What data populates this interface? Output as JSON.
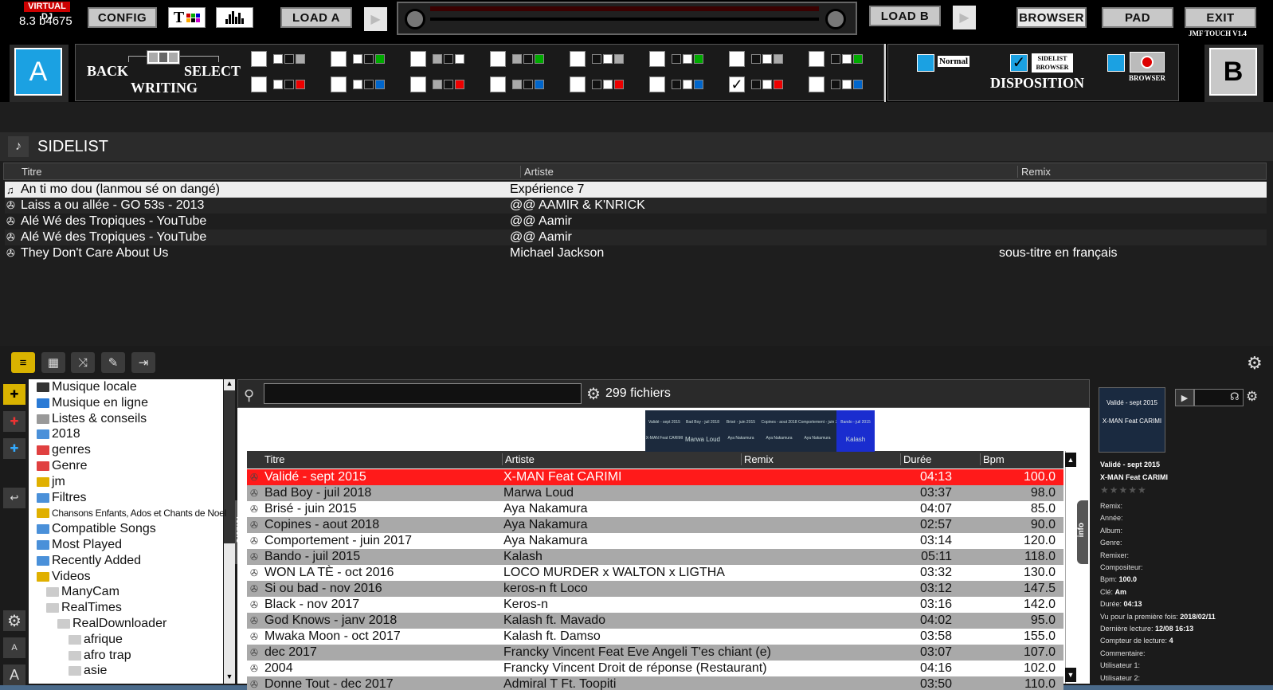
{
  "app": {
    "logo": "VIRTUAL DJ",
    "version": "8.3 b4675",
    "skin_tag": "JMF TOUCH  V1.4"
  },
  "topbar": {
    "config": "CONFIG",
    "load_a": "LOAD A",
    "load_b": "LOAD B",
    "browser": "BROWSER",
    "pad": "PAD",
    "exit": "EXIT"
  },
  "deck": {
    "a": "A",
    "b": "B"
  },
  "writing": {
    "back": "BACK",
    "select": "SELECT",
    "writing": "WRITING"
  },
  "disposition": {
    "normal": "Normal",
    "sidelist_browser": "SIDELIST BROWSER",
    "browser": "BROWSER",
    "title": "DISPOSITION"
  },
  "sidelist": {
    "title": "SIDELIST",
    "cols": [
      "Titre",
      "Artiste",
      "Remix"
    ],
    "rows": [
      {
        "titre": "An ti mo dou (lanmou sé on dangé)",
        "artiste": "Expérience 7",
        "remix": ""
      },
      {
        "titre": "Laiss a ou allée - GO 53s - 2013",
        "artiste": "@@ AAMIR & K'NRICK",
        "remix": ""
      },
      {
        "titre": "Alé Wé des Tropiques - YouTube",
        "artiste": "@@ Aamir",
        "remix": ""
      },
      {
        "titre": "Alé Wé des Tropiques - YouTube",
        "artiste": "@@ Aamir",
        "remix": ""
      },
      {
        "titre": "They Don't Care About Us",
        "artiste": "Michael Jackson",
        "remix": "sous-titre en français"
      }
    ]
  },
  "folders": [
    "Musique locale",
    "Musique en ligne",
    "Listes & conseils",
    "2018",
    "genres",
    "Genre",
    "jm",
    "Filtres",
    "Chansons Enfants, Ados et Chants de Noel",
    "Compatible Songs",
    "Most Played",
    "Recently Added",
    "Videos",
    "ManyCam",
    "RealTimes",
    "RealDownloader",
    "afrique",
    "afro trap",
    "asie"
  ],
  "folders_tab": "folders",
  "info_tab": "info",
  "search": {
    "value": "",
    "count": "299 fichiers"
  },
  "browser": {
    "cols": [
      "Titre",
      "Artiste",
      "Remix",
      "Durée",
      "Bpm"
    ],
    "rows": [
      {
        "titre": "Validé - sept 2015",
        "artiste": "X-MAN Feat CARIMI",
        "remix": "",
        "duree": "04:13",
        "bpm": "100.0"
      },
      {
        "titre": "Bad Boy - juil 2018",
        "artiste": "Marwa Loud",
        "remix": "",
        "duree": "03:37",
        "bpm": "98.0"
      },
      {
        "titre": "Brisé - juin 2015",
        "artiste": "Aya Nakamura",
        "remix": "",
        "duree": "04:07",
        "bpm": "85.0"
      },
      {
        "titre": "Copines - aout 2018",
        "artiste": "Aya Nakamura",
        "remix": "",
        "duree": "02:57",
        "bpm": "90.0"
      },
      {
        "titre": "Comportement - juin 2017",
        "artiste": "Aya Nakamura",
        "remix": "",
        "duree": "03:14",
        "bpm": "120.0"
      },
      {
        "titre": "Bando - juil 2015",
        "artiste": "Kalash",
        "remix": "",
        "duree": "05:11",
        "bpm": "118.0"
      },
      {
        "titre": "WON LA TÈ - oct 2016",
        "artiste": "LOCO MURDER x WALTON x LIGTHA",
        "remix": "",
        "duree": "03:32",
        "bpm": "130.0"
      },
      {
        "titre": "Si ou bad - nov 2016",
        "artiste": "keros-n ft Loco",
        "remix": "",
        "duree": "03:12",
        "bpm": "147.5"
      },
      {
        "titre": "Black - nov 2017",
        "artiste": "Keros-n",
        "remix": "",
        "duree": "03:16",
        "bpm": "142.0"
      },
      {
        "titre": "God Knows - janv 2018",
        "artiste": "Kalash ft. Mavado",
        "remix": "",
        "duree": "04:02",
        "bpm": "95.0"
      },
      {
        "titre": "Mwaka Moon - oct 2017",
        "artiste": "Kalash ft. Damso",
        "remix": "",
        "duree": "03:58",
        "bpm": "155.0"
      },
      {
        "titre": "dec 2017",
        "artiste": "Francky Vincent Feat Eve Angeli T'es chiant (e)",
        "remix": "",
        "duree": "03:07",
        "bpm": "107.0"
      },
      {
        "titre": "2004",
        "artiste": "Francky Vincent  Droit de réponse (Restaurant)",
        "remix": "",
        "duree": "04:16",
        "bpm": "102.0"
      },
      {
        "titre": "Donne Tout - dec 2017",
        "artiste": "Admiral T Ft. Toopiti",
        "remix": "",
        "duree": "03:50",
        "bpm": "110.0"
      }
    ]
  },
  "thumbs": {
    "top": [
      "Validé - sept 2015",
      "Bad Boy - juil 2018",
      "Brisé - juin 2015",
      "Copines - aout 2018",
      "Comportement - juin 2017",
      "Bando - juil 2015"
    ],
    "bottom": [
      "X-MAN Feat CARIMI",
      "Marwa Loud",
      "Aya Nakamura",
      "Aya Nakamura",
      "Aya Nakamura",
      "Kalash"
    ]
  },
  "info": {
    "cover_top": "Validé - sept 2015",
    "cover_bottom": "X-MAN Feat CARIMI",
    "title": "Validé - sept 2015",
    "artist": "X-MAN Feat CARIMI",
    "fields": [
      {
        "label": "Remix:",
        "value": ""
      },
      {
        "label": "Année:",
        "value": ""
      },
      {
        "label": "Album:",
        "value": ""
      },
      {
        "label": "Genre:",
        "value": ""
      },
      {
        "label": "Remixer:",
        "value": ""
      },
      {
        "label": "Compositeur:",
        "value": ""
      },
      {
        "label": "Bpm:",
        "value": "100.0"
      },
      {
        "label": "Clé:",
        "value": "Am"
      },
      {
        "label": "Durée:",
        "value": "04:13"
      },
      {
        "label": "Vu pour la première fois:",
        "value": "2018/02/11"
      },
      {
        "label": "Dernière lecture:",
        "value": "12/08 16:13"
      },
      {
        "label": "Compteur de lecture:",
        "value": "4"
      },
      {
        "label": "Commentaire:",
        "value": ""
      },
      {
        "label": "Utilisateur 1:",
        "value": ""
      },
      {
        "label": "Utilisateur 2:",
        "value": ""
      }
    ]
  },
  "left_buttons": {
    "small_a": "A",
    "big_a": "A"
  },
  "colors": {
    "accent": "#1ba1e2",
    "selected": "#ff1a1a",
    "sidebar_yellow": "#e0b800"
  }
}
